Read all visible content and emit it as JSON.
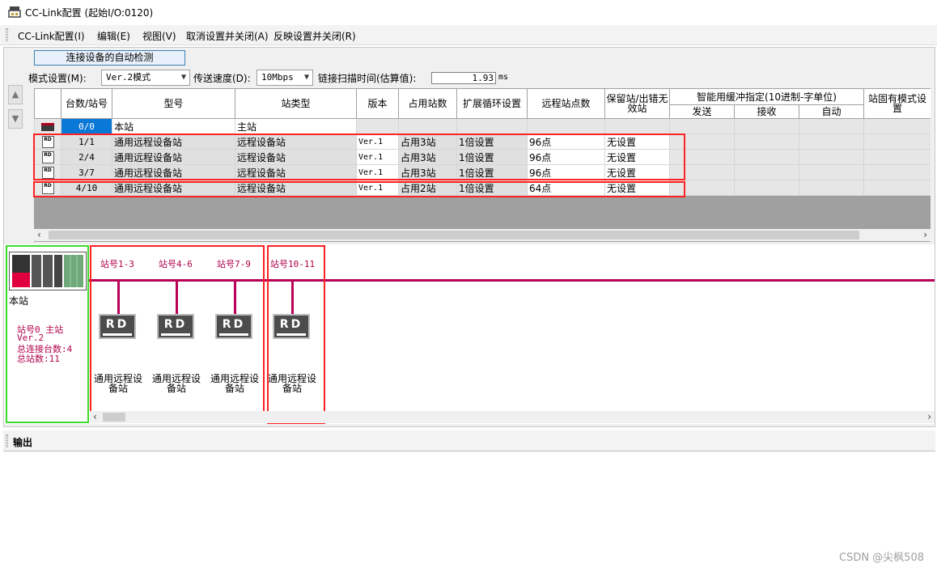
{
  "window": {
    "title": "CC-Link配置 (起始I/O:0120)"
  },
  "menu": [
    {
      "label": "CC-Link配置(I)"
    },
    {
      "label": "编辑(E)"
    },
    {
      "label": "视图(V)"
    },
    {
      "label": "取消设置并关闭(A)"
    },
    {
      "label": "反映设置并关闭(R)"
    }
  ],
  "toolbar": {
    "detect_button": "连接设备的自动检测",
    "mode_label": "模式设置(M):",
    "mode_value": "Ver.2模式",
    "speed_label": "传送速度(D):",
    "speed_value": "10Mbps",
    "scan_label": "链接扫描时间(估算值):",
    "scan_value": "1.93",
    "scan_unit": "ms"
  },
  "table": {
    "headers": {
      "unit_station": "台数/站号",
      "model": "型号",
      "station_type": "站类型",
      "version": "版本",
      "occupied": "占用站数",
      "ext_cycle": "扩展循环设置",
      "remote_points": "远程站点数",
      "reserved": "保留站/出错无效站",
      "buffer_group": "智能用缓冲指定(10进制-字单位)",
      "send": "发送",
      "receive": "接收",
      "auto": "自动",
      "fixed_mode": "站固有模式设置"
    },
    "master_row": {
      "icon": "master-icon",
      "unit_station": "0/0",
      "model": "本站",
      "station_type": "主站"
    },
    "rows": [
      {
        "badge": "RD",
        "unit_station": "1/1",
        "model": "通用远程设备站",
        "station_type": "远程设备站",
        "version": "Ver.1",
        "occupied": "占用3站",
        "ext_cycle": "1倍设置",
        "points": "96点",
        "reserved": "无设置"
      },
      {
        "badge": "RD",
        "unit_station": "2/4",
        "model": "通用远程设备站",
        "station_type": "远程设备站",
        "version": "Ver.1",
        "occupied": "占用3站",
        "ext_cycle": "1倍设置",
        "points": "96点",
        "reserved": "无设置"
      },
      {
        "badge": "RD",
        "unit_station": "3/7",
        "model": "通用远程设备站",
        "station_type": "远程设备站",
        "version": "Ver.1",
        "occupied": "占用3站",
        "ext_cycle": "1倍设置",
        "points": "96点",
        "reserved": "无设置"
      },
      {
        "badge": "RD",
        "unit_station": "4/10",
        "model": "通用远程设备站",
        "station_type": "远程设备站",
        "version": "Ver.1",
        "occupied": "占用2站",
        "ext_cycle": "1倍设置",
        "points": "64点",
        "reserved": "无设置"
      }
    ]
  },
  "diagram": {
    "master": {
      "label": "本站",
      "info": [
        "站号0  主站",
        "Ver.2",
        "总连接台数:4",
        "总站数:11"
      ]
    },
    "stations": [
      {
        "number_label": "站号1-3",
        "box": "RD",
        "name": "通用远程设备站"
      },
      {
        "number_label": "站号4-6",
        "box": "RD",
        "name": "通用远程设备站"
      },
      {
        "number_label": "站号7-9",
        "box": "RD",
        "name": "通用远程设备站"
      },
      {
        "number_label": "站号10-11",
        "box": "RD",
        "name": "通用远程设备站"
      }
    ]
  },
  "output": {
    "title": "输出"
  },
  "watermark": "CSDN @尖枫508",
  "colors": {
    "bus": "#b80057",
    "highlight_red": "#ff2222",
    "highlight_green": "#3cdc2c",
    "selection": "#0a78d7"
  }
}
